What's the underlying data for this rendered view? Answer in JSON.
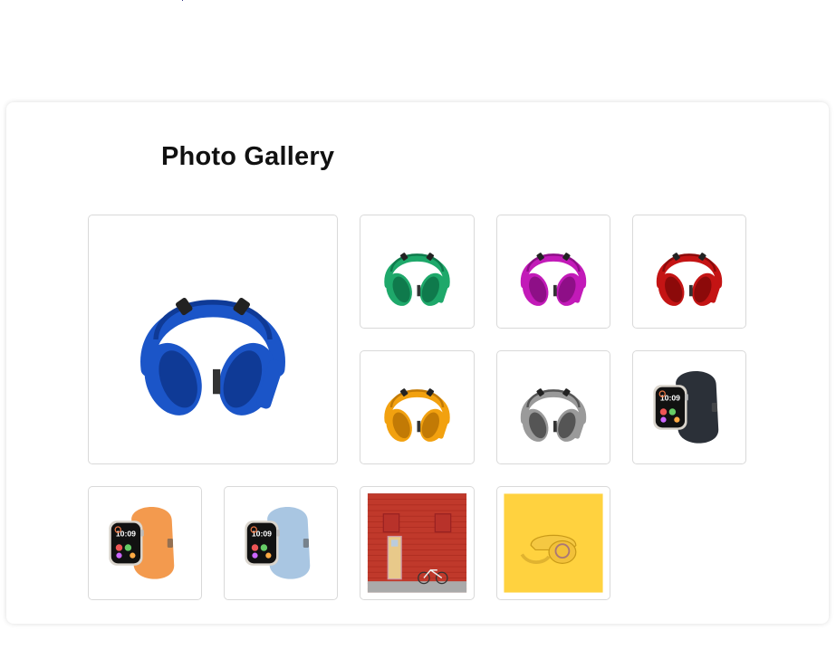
{
  "gallery": {
    "title": "Photo Gallery",
    "items": [
      {
        "name": "blue-headphones",
        "kind": "headphones",
        "color": "#1b55c8",
        "dark": "#0f3a96"
      },
      {
        "name": "green-headphones",
        "kind": "headphones",
        "color": "#1ea86a",
        "dark": "#0f7a4c"
      },
      {
        "name": "magenta-headphones",
        "kind": "headphones",
        "color": "#c21ab8",
        "dark": "#8e0f87"
      },
      {
        "name": "red-headphones",
        "kind": "headphones",
        "color": "#c41414",
        "dark": "#8c0a0a"
      },
      {
        "name": "orange-headphones",
        "kind": "headphones",
        "color": "#f2a10f",
        "dark": "#c27a05"
      },
      {
        "name": "gray-headphones",
        "kind": "headphones",
        "color": "#9a9a9a",
        "dark": "#555555"
      },
      {
        "name": "midnight-watch",
        "kind": "watch",
        "band": "#2b3038",
        "case": "#d9d4cc",
        "time": "10:09"
      },
      {
        "name": "orange-watch",
        "kind": "watch",
        "band": "#f39a4e",
        "case": "#d9d4cc",
        "time": "10:09"
      },
      {
        "name": "blue-watch",
        "kind": "watch",
        "band": "#a9c6e2",
        "case": "#d9d4cc",
        "time": "10:09"
      },
      {
        "name": "red-wall-photo",
        "kind": "wall",
        "color": "#c0392b"
      },
      {
        "name": "yellow-phone-photo",
        "kind": "phone",
        "color": "#ffd23f"
      }
    ]
  }
}
